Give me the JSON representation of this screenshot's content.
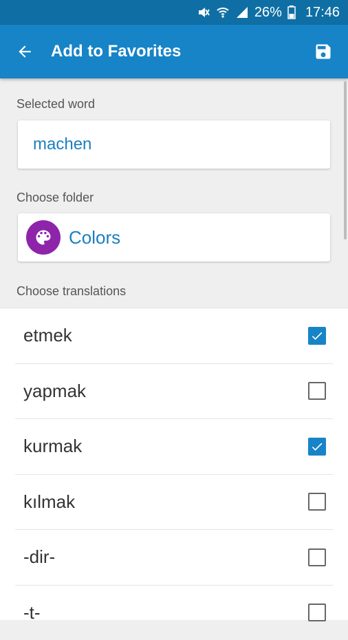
{
  "status_bar": {
    "battery": "26%",
    "time": "17:46",
    "icons": [
      "mute-icon",
      "wifi-icon",
      "signal-icon",
      "battery-icon"
    ]
  },
  "app_bar": {
    "title": "Add to Favorites",
    "back_icon": "arrow-back-icon",
    "save_icon": "save-icon"
  },
  "selected_word": {
    "label": "Selected word",
    "value": "machen"
  },
  "folder": {
    "label": "Choose folder",
    "name": "Colors",
    "icon": "palette-icon",
    "avatar_color": "#8e24aa"
  },
  "translations": {
    "label": "Choose translations",
    "items": [
      {
        "text": "etmek",
        "checked": true
      },
      {
        "text": "yapmak",
        "checked": false
      },
      {
        "text": "kurmak",
        "checked": true
      },
      {
        "text": "kılmak",
        "checked": false
      },
      {
        "text": "-dir-",
        "checked": false
      },
      {
        "text": "-t-",
        "checked": false
      }
    ]
  },
  "colors": {
    "app_bar": "#1784c7",
    "status_bar": "#0f6fa5",
    "accent_text": "#1b7fc0"
  }
}
